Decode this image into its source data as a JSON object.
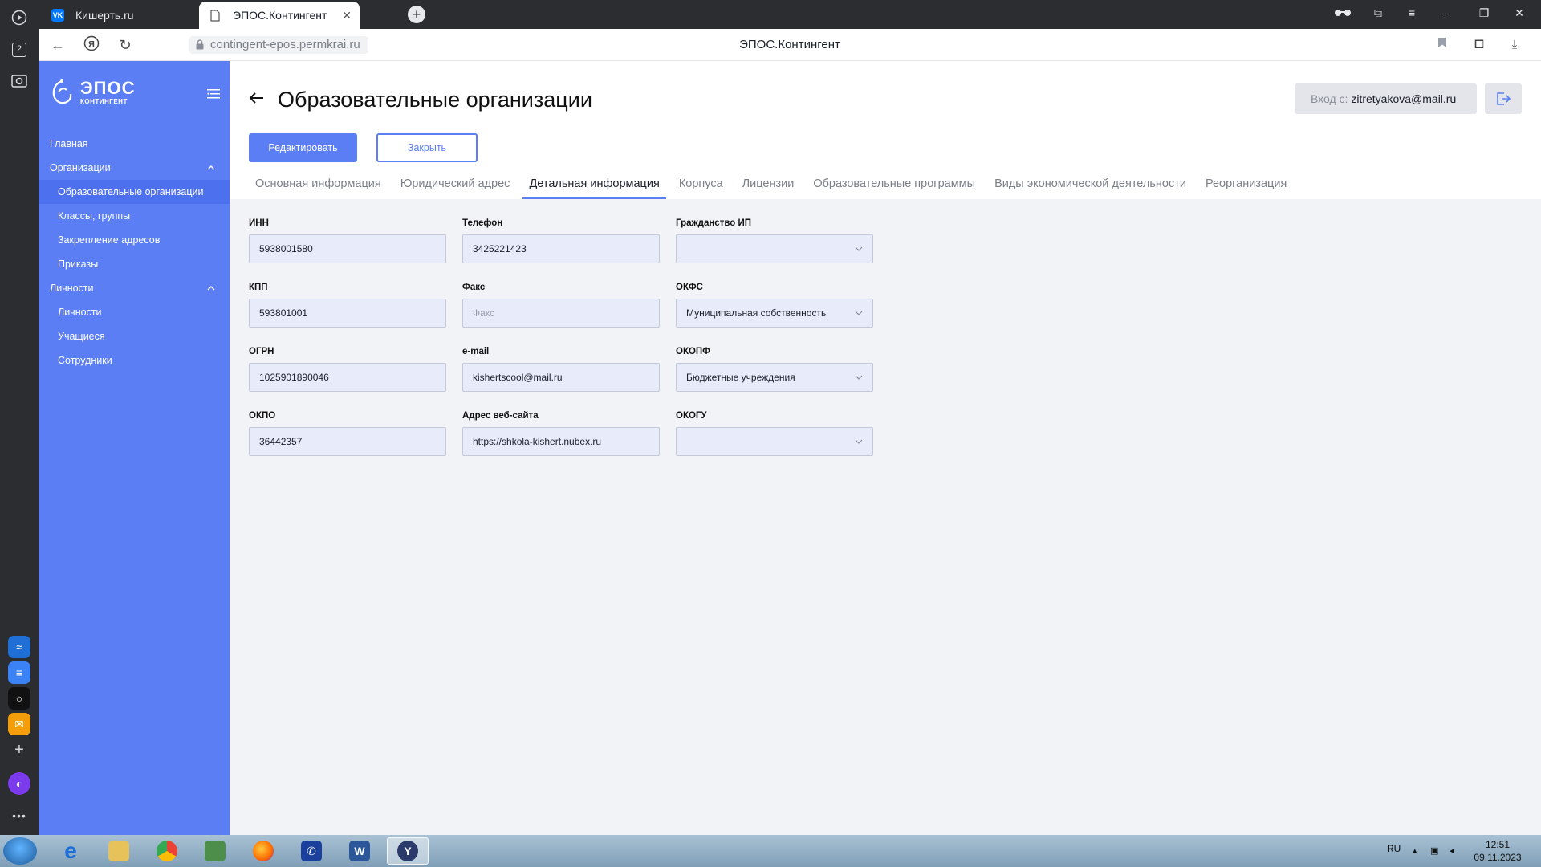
{
  "browser": {
    "tabs": [
      {
        "label": "Кишерть.ru",
        "favicon": "vk-icon"
      },
      {
        "label": "ЭПОС.Контингент",
        "favicon": "document-icon",
        "active": true
      }
    ],
    "url": "contingent-epos.permkrai.ru",
    "window_title": "ЭПОС.Контингент",
    "rail_badge": "2"
  },
  "sidebar": {
    "logo_title": "ЭПОС",
    "logo_subtitle": "КОНТИНГЕНТ",
    "items": [
      {
        "label": "Главная",
        "level": 0
      },
      {
        "label": "Организации",
        "level": 0,
        "expanded": true
      },
      {
        "label": "Образовательные организации",
        "level": 1,
        "active": true
      },
      {
        "label": "Классы, группы",
        "level": 1
      },
      {
        "label": "Закрепление адресов",
        "level": 1
      },
      {
        "label": "Приказы",
        "level": 1
      },
      {
        "label": "Личности",
        "level": 0,
        "expanded": true
      },
      {
        "label": "Личности",
        "level": 1
      },
      {
        "label": "Учащиеся",
        "level": 1
      },
      {
        "label": "Сотрудники",
        "level": 1
      }
    ]
  },
  "header": {
    "title": "Образовательные организации",
    "login_prefix": "Вход с: ",
    "login_email": "zitretyakova@mail.ru"
  },
  "actions": {
    "edit_label": "Редактировать",
    "close_label": "Закрыть"
  },
  "tabs": [
    {
      "label": "Основная информация"
    },
    {
      "label": "Юридический адрес"
    },
    {
      "label": "Детальная информация",
      "active": true
    },
    {
      "label": "Корпуса"
    },
    {
      "label": "Лицензии"
    },
    {
      "label": "Образовательные программы"
    },
    {
      "label": "Виды экономической деятельности"
    },
    {
      "label": "Реорганизация"
    }
  ],
  "form": {
    "inn": {
      "label": "ИНН",
      "value": "5938001580"
    },
    "phone": {
      "label": "Телефон",
      "value": "3425221423"
    },
    "citizenship": {
      "label": "Гражданство ИП",
      "value": ""
    },
    "kpp": {
      "label": "КПП",
      "value": "593801001"
    },
    "fax": {
      "label": "Факс",
      "value": "",
      "placeholder": "Факс"
    },
    "okfs": {
      "label": "ОКФС",
      "value": "Муниципальная собственность"
    },
    "ogrn": {
      "label": "ОГРН",
      "value": "1025901890046"
    },
    "email": {
      "label": "e-mail",
      "value": "kishertscool@mail.ru"
    },
    "okopf": {
      "label": "ОКОПФ",
      "value": "Бюджетные учреждения"
    },
    "okpo": {
      "label": "ОКПО",
      "value": "36442357"
    },
    "website": {
      "label": "Адрес веб-сайта",
      "value": "https://shkola-kishert.nubex.ru"
    },
    "okogu": {
      "label": "ОКОГУ",
      "value": ""
    }
  },
  "taskbar": {
    "language": "RU",
    "time": "12:51",
    "date": "09.11.2023"
  },
  "colors": {
    "accent": "#5b7ef5",
    "sidebar_bg": "#5b7ef5",
    "input_bg": "#e8ebf9"
  }
}
